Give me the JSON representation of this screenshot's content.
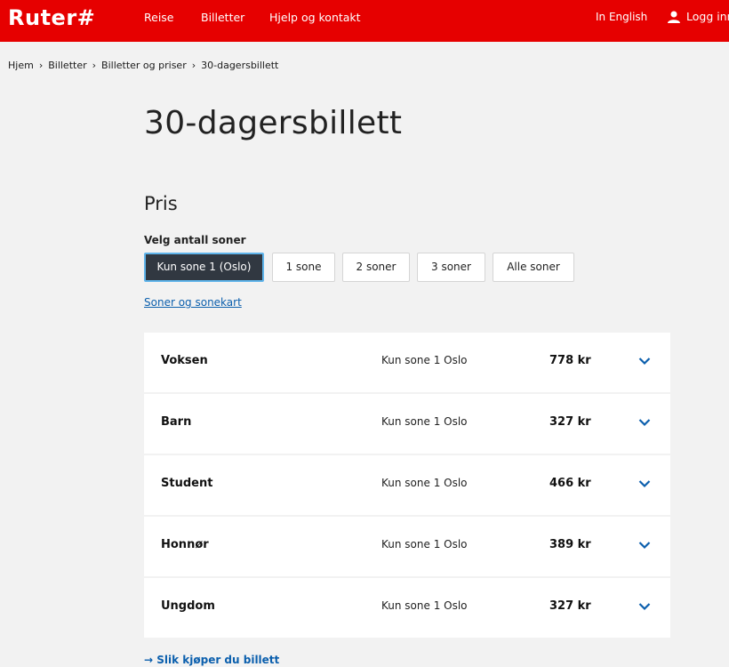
{
  "header": {
    "logo": "Ruter#",
    "nav": [
      "Reise",
      "Billetter",
      "Hjelp og kontakt"
    ],
    "language": "In English",
    "login": "Logg inn"
  },
  "breadcrumb": [
    "Hjem",
    "Billetter",
    "Billetter og priser",
    "30-dagersbillett"
  ],
  "page_title": "30-dagersbillett",
  "section_title": "Pris",
  "zones": {
    "label": "Velg antall soner",
    "options": [
      "Kun sone 1 (Oslo)",
      "1 sone",
      "2 soner",
      "3 soner",
      "Alle soner"
    ],
    "selected": "Kun sone 1 (Oslo)",
    "map_link": "Soner og sonekart"
  },
  "prices": [
    {
      "category": "Voksen",
      "zone": "Kun sone 1 Oslo",
      "price": "778 kr"
    },
    {
      "category": "Barn",
      "zone": "Kun sone 1 Oslo",
      "price": "327 kr"
    },
    {
      "category": "Student",
      "zone": "Kun sone 1 Oslo",
      "price": "466 kr"
    },
    {
      "category": "Honnør",
      "zone": "Kun sone 1 Oslo",
      "price": "389 kr"
    },
    {
      "category": "Ungdom",
      "zone": "Kun sone 1 Oslo",
      "price": "327 kr"
    }
  ],
  "buy_link": "Slik kjøper du billett",
  "colors": {
    "brand": "#e60000",
    "selected_bg": "#313841",
    "link": "#0b5fad",
    "focus": "#5fb4ea"
  }
}
